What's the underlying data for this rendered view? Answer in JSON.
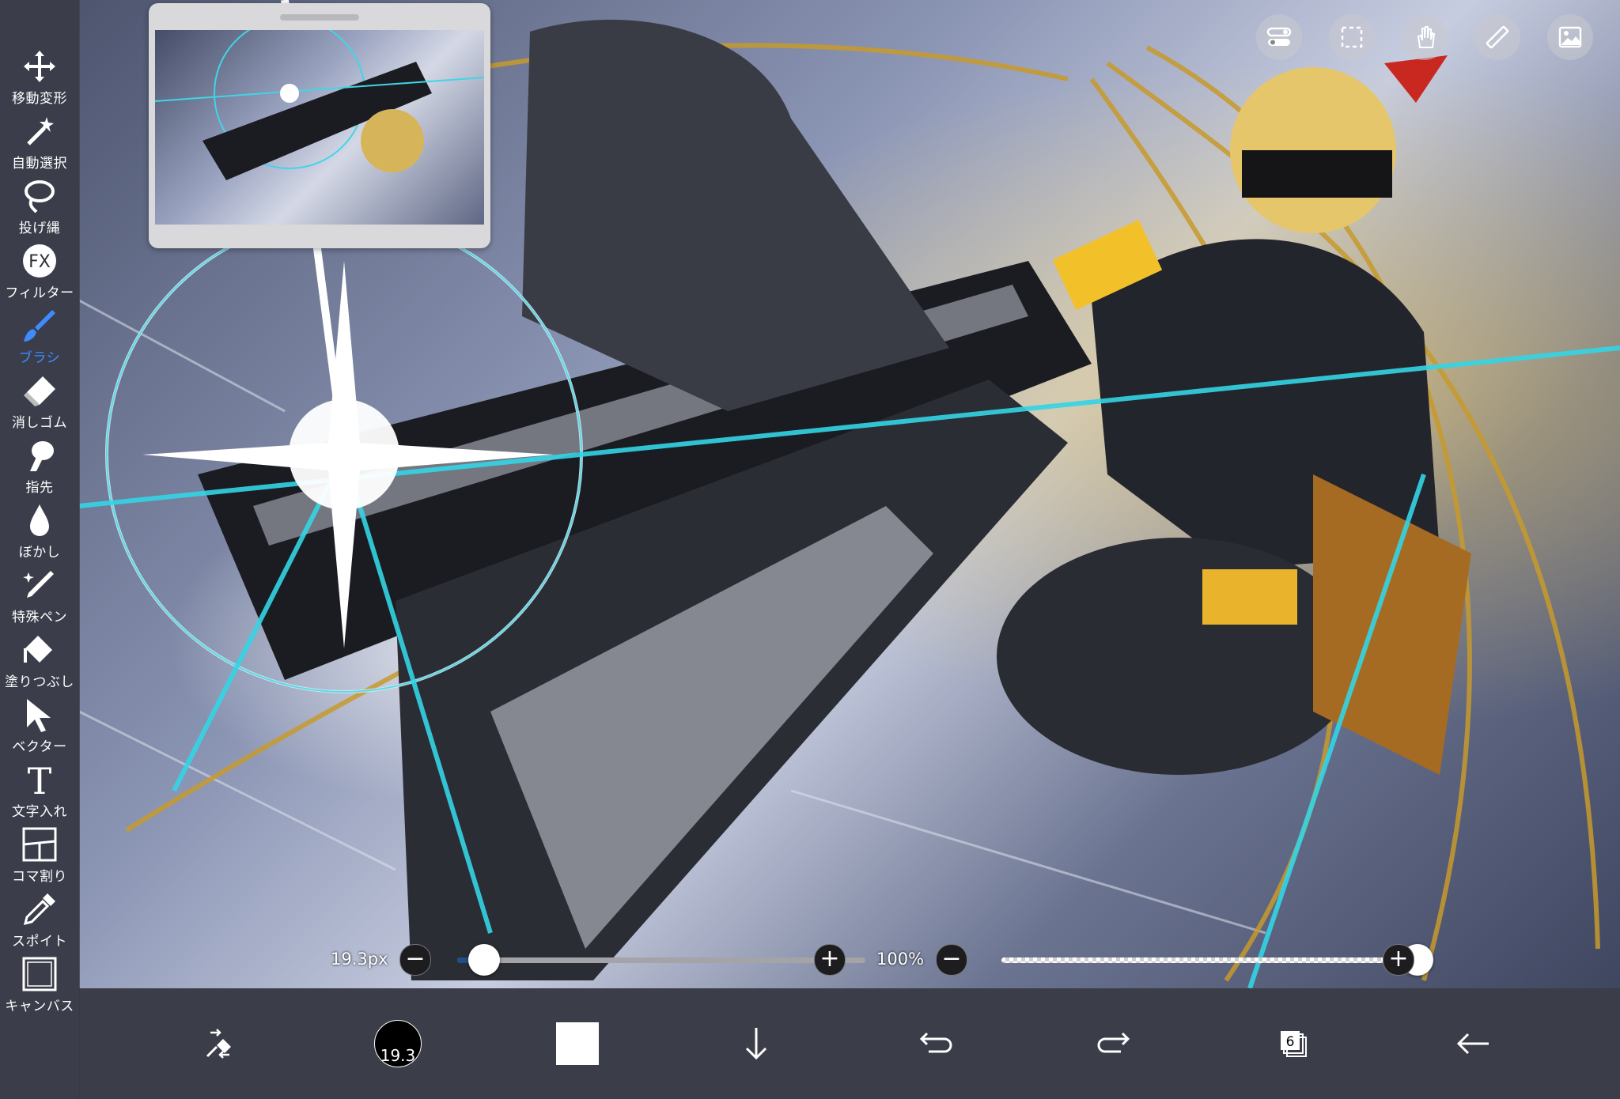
{
  "toolbar": {
    "tools": [
      {
        "label": "移動変形",
        "icon": "move-icon"
      },
      {
        "label": "自動選択",
        "icon": "magic-wand-icon"
      },
      {
        "label": "投げ縄",
        "icon": "lasso-icon"
      },
      {
        "label": "フィルター",
        "icon": "fx-icon",
        "icon_text": "FX"
      },
      {
        "label": "ブラシ",
        "icon": "brush-icon",
        "active": true
      },
      {
        "label": "消しゴム",
        "icon": "eraser-icon"
      },
      {
        "label": "指先",
        "icon": "finger-icon"
      },
      {
        "label": "ぼかし",
        "icon": "blur-drop-icon"
      },
      {
        "label": "特殊ペン",
        "icon": "special-pen-icon"
      },
      {
        "label": "塗りつぶし",
        "icon": "bucket-fill-icon"
      },
      {
        "label": "ベクター",
        "icon": "vector-cursor-icon"
      },
      {
        "label": "文字入れ",
        "icon": "text-tool-icon",
        "icon_text": "T"
      },
      {
        "label": "コマ割り",
        "icon": "frame-divider-icon"
      },
      {
        "label": "スポイト",
        "icon": "eyedropper-icon"
      },
      {
        "label": "キャンバス",
        "icon": "canvas-icon"
      }
    ]
  },
  "top_buttons": [
    "toggle-panel-icon",
    "selection-frame-icon",
    "hand-gesture-icon",
    "ruler-icon",
    "material-image-icon"
  ],
  "brush_size": {
    "readout": "19.3px",
    "value_fraction": 0.04
  },
  "opacity": {
    "readout": "100%",
    "value_fraction": 1.0
  },
  "bottom_bar": {
    "brush_size_chip": "19.3",
    "color_hex": "#ffffff",
    "layer_count": "6",
    "icons": [
      "swap-tool-icon",
      "brush-size-icon",
      "color-swatch-icon",
      "download-arrow-icon",
      "undo-icon",
      "redo-icon",
      "layers-icon",
      "back-arrow-icon"
    ]
  },
  "colors": {
    "accent": "#3e8bff",
    "toolbar_bg": "#30323a",
    "slider_fill": "#1f4f88"
  }
}
